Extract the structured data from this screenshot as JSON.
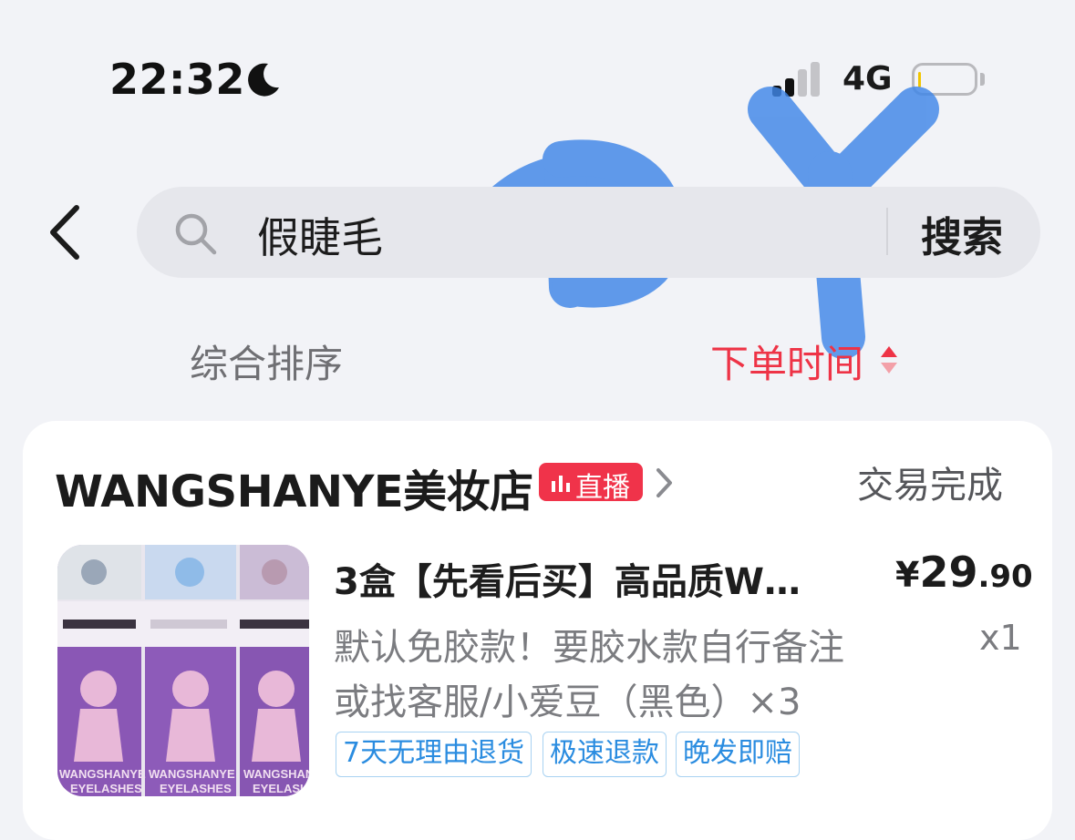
{
  "status_bar": {
    "time": "22:32",
    "network": "4G",
    "moon_icon": "moon-icon",
    "signal_icon": "signal-bars-icon",
    "battery_icon": "battery-low-icon"
  },
  "search": {
    "query": "假睫毛",
    "button_label": "搜索",
    "icons": [
      "back-chevron-icon",
      "search-icon"
    ]
  },
  "sort_bar": {
    "option_comprehensive": "综合排序",
    "option_order_time": "下单时间",
    "active_color": "#ee3346"
  },
  "watermark": {
    "text": "DY",
    "color": "#3b82e6"
  },
  "order": {
    "shop_name": "WANGSHANYE美妆店",
    "live_badge": "直播",
    "status": "交易完成",
    "product": {
      "title": "3盒【先看后买】高品质W…",
      "price_symbol": "¥",
      "price_integer": "29",
      "price_decimal": ".90",
      "spec_line1": "默认免胶款！要胶水款自行备注",
      "spec_line2": "或找客服/小爱豆（黑色）×3",
      "quantity": "x1",
      "thumbnail_text_1": "WANGSHANYE",
      "thumbnail_text_2": "EYELASHES",
      "tags": [
        "7天无理由退货",
        "极速退款",
        "晚发即赔"
      ]
    },
    "badge_color": "#f0334a",
    "tag_color": "#2a8ce0"
  }
}
